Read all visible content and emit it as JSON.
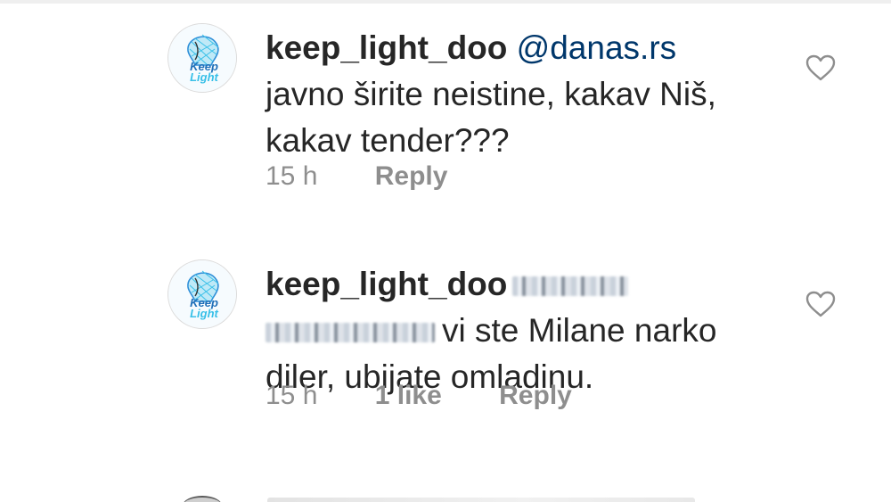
{
  "comments": [
    {
      "username": "keep_light_doo",
      "mention": "@danas.rs",
      "text_lines": [
        "javno širite neistine, kakav Niš,",
        "kakav tender???"
      ],
      "time": "15 h",
      "likes_label": "",
      "reply_label": "Reply",
      "avatar_text": [
        "Keep",
        "Light"
      ]
    },
    {
      "username": "keep_light_doo",
      "text_after_blur": "vi ste Milane narko",
      "text_line_2": "diler, ubijate omladinu.",
      "time": "15 h",
      "likes_label": "1 like",
      "reply_label": "Reply",
      "avatar_text": [
        "Keep",
        "Light"
      ]
    }
  ],
  "icons": {
    "like": "heart-outline-icon"
  },
  "colors": {
    "text": "#262626",
    "secondary": "#8e8e8e",
    "mention": "#00376b",
    "logo_blue": "#2f8fd8",
    "logo_cyan": "#39c0e8"
  }
}
